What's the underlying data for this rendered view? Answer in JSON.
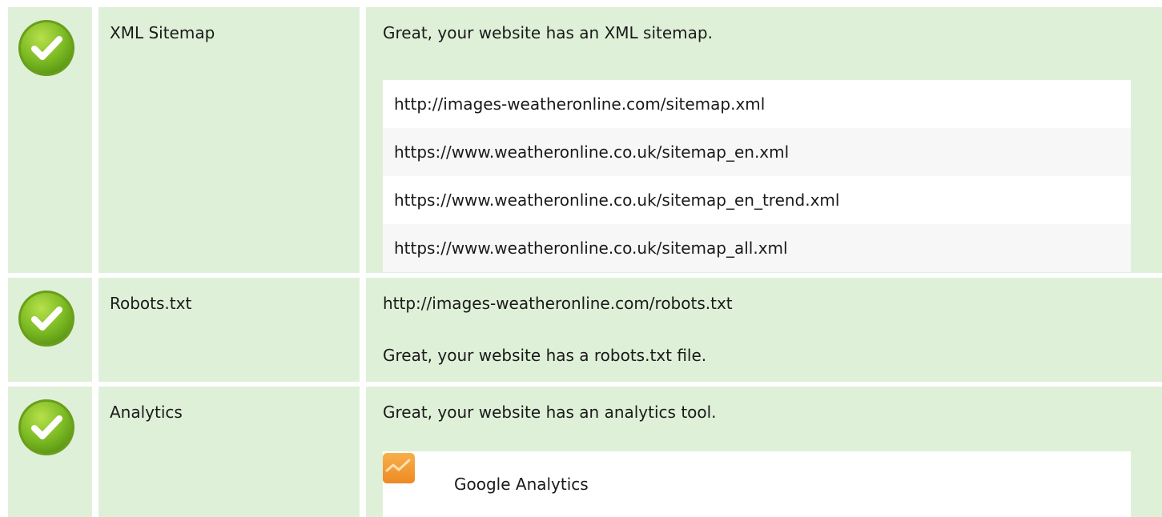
{
  "checks": [
    {
      "status_icon": "check-circle-icon",
      "factor": "XML Sitemap",
      "message": "Great, your website has an XML sitemap.",
      "sitemaps": [
        "http://images-weatheronline.com/sitemap.xml",
        "https://www.weatheronline.co.uk/sitemap_en.xml",
        "https://www.weatheronline.co.uk/sitemap_en_trend.xml",
        "https://www.weatheronline.co.uk/sitemap_all.xml"
      ]
    },
    {
      "status_icon": "check-circle-icon",
      "factor": "Robots.txt",
      "url": "http://images-weatheronline.com/robots.txt",
      "message": "Great, your website has a robots.txt file."
    },
    {
      "status_icon": "check-circle-icon",
      "factor": "Analytics",
      "message": "Great, your website has an analytics tool.",
      "tools": [
        {
          "icon": "google-analytics-icon",
          "name": "Google Analytics"
        }
      ]
    }
  ],
  "colors": {
    "row_background": "#dff0d8",
    "check_green": "#7dbb24",
    "analytics_orange": "#f39c3a"
  }
}
